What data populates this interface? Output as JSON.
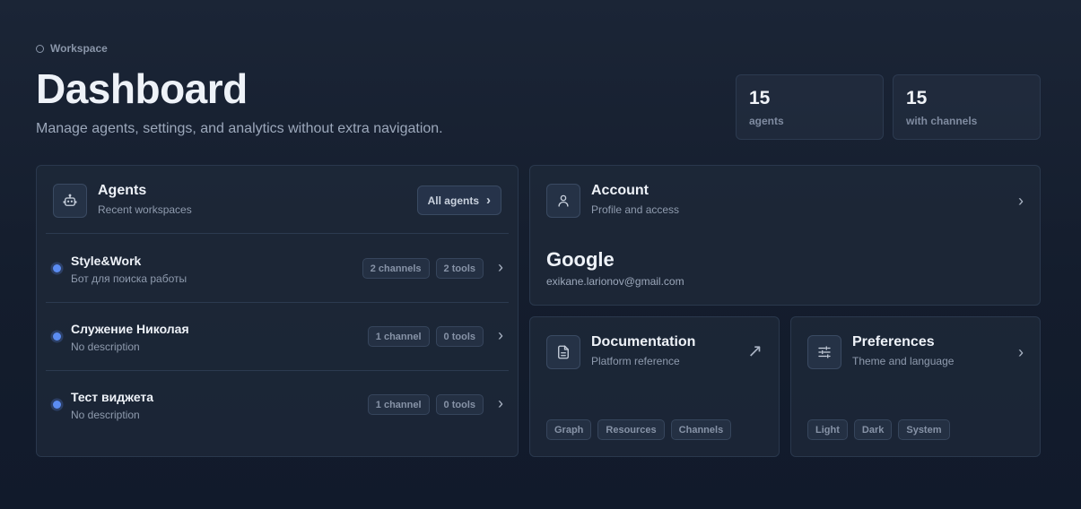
{
  "header": {
    "eyebrow": "Workspace",
    "title": "Dashboard",
    "subtitle": "Manage agents, settings, and analytics without extra navigation."
  },
  "stats": [
    {
      "value": "15",
      "label": "agents"
    },
    {
      "value": "15",
      "label": "with channels"
    }
  ],
  "agents_card": {
    "title": "Agents",
    "subtitle": "Recent workspaces",
    "all_button": "All agents",
    "items": [
      {
        "name": "Style&Work",
        "description": "Бот для поиска работы",
        "channels": "2 channels",
        "tools": "2 tools"
      },
      {
        "name": "Служение Николая",
        "description": "No description",
        "channels": "1 channel",
        "tools": "0 tools"
      },
      {
        "name": "Тест виджета",
        "description": "No description",
        "channels": "1 channel",
        "tools": "0 tools"
      }
    ]
  },
  "account_card": {
    "title": "Account",
    "subtitle": "Profile and access",
    "provider": "Google",
    "email": "exikane.larionov@gmail.com"
  },
  "docs_card": {
    "title": "Documentation",
    "subtitle": "Platform reference",
    "chips": [
      "Graph",
      "Resources",
      "Channels"
    ]
  },
  "prefs_card": {
    "title": "Preferences",
    "subtitle": "Theme and language",
    "chips": [
      "Light",
      "Dark",
      "System"
    ]
  },
  "icons": {
    "chevron": "›",
    "external": "↗"
  },
  "colors": {
    "accent_dot": "#5b8cf2",
    "background": "#161f30"
  }
}
